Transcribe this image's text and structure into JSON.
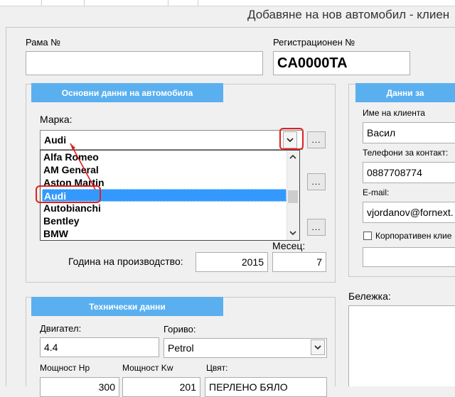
{
  "window": {
    "title": "Добавяне на нов автомобил - клиен"
  },
  "frame": {
    "chassis": {
      "label": "Рама №",
      "value": ""
    },
    "registration": {
      "label": "Регистрационен №",
      "value": "CA0000TA"
    }
  },
  "basic": {
    "header": "Основни данни на автомобила",
    "make_label": "Марка:",
    "make_value": "Audi",
    "browse_label": "...",
    "dropdown": {
      "items": [
        "Alfa Romeo",
        "AM General",
        "Aston Martin",
        "Audi",
        "Autobianchi",
        "Bentley",
        "BMW"
      ],
      "selected": "Audi"
    },
    "year_label": "Година на производство:",
    "year_value": "2015",
    "month_label": "Месец:",
    "month_value": "7"
  },
  "client": {
    "header": "Данни за",
    "name_label": "Име на клиента",
    "name_value": "Васил",
    "phone_label": "Телефони за контакт:",
    "phone_value": "0887708774",
    "email_label": "E-mail:",
    "email_value": "vjordanov@fornext.",
    "corporate_label": "Корпоративен клие",
    "corporate_checked": false
  },
  "tech": {
    "header": "Технически данни",
    "engine_label": "Двигател:",
    "engine_value": "4.4",
    "fuel_label": "Гориво:",
    "fuel_value": "Petrol",
    "power_hp_label": "Мощност Hp",
    "power_hp_value": "300",
    "power_kw_label": "Мощност Kw",
    "power_kw_value": "201",
    "color_label": "Цвят:",
    "color_value": "ПЕРЛЕНО БЯЛО"
  },
  "note": {
    "label": "Бележка:"
  },
  "colors": {
    "accent": "#5ab0ef",
    "selection": "#3399ff",
    "annotation": "#e02020"
  },
  "icons": {
    "dropdown": "chevron-down-icon",
    "scroll_up": "chevron-up-icon",
    "scroll_down": "chevron-down-icon"
  }
}
